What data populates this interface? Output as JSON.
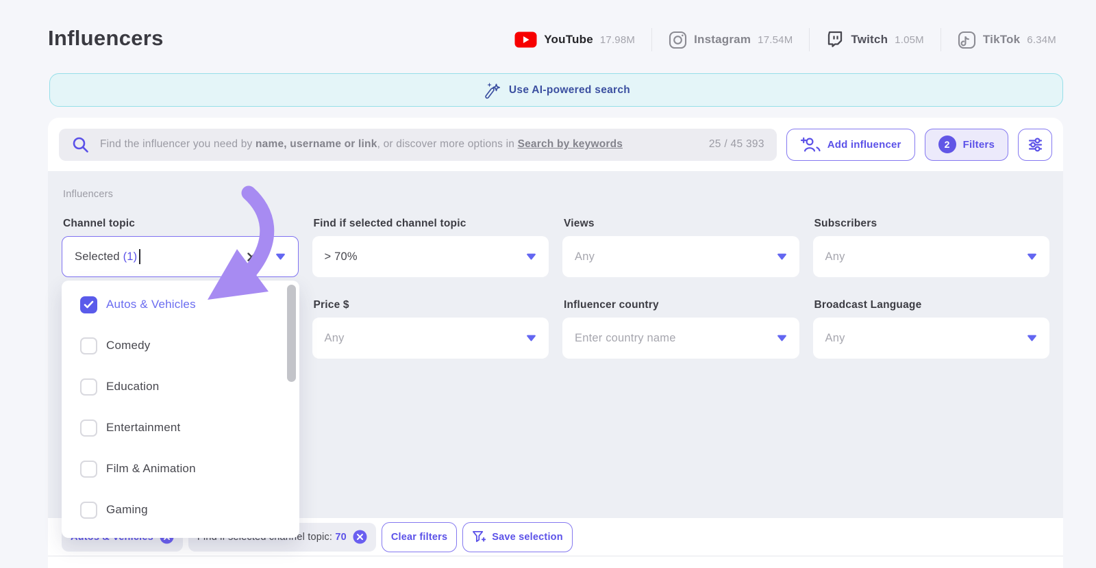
{
  "page": {
    "title": "Influencers"
  },
  "platforms": [
    {
      "name": "YouTube",
      "count": "17.98M"
    },
    {
      "name": "Instagram",
      "count": "17.54M"
    },
    {
      "name": "Twitch",
      "count": "1.05M"
    },
    {
      "name": "TikTok",
      "count": "6.34M"
    }
  ],
  "ai_banner": {
    "label": "Use AI-powered search"
  },
  "search": {
    "placeholder_prefix": "Find the influencer you need by ",
    "placeholder_bold": "name, username or link",
    "placeholder_middle": ", or discover more options in ",
    "placeholder_link": "Search by keywords",
    "results_count": "25 / 45 393"
  },
  "toolbar": {
    "add_influencer_label": "Add influencer",
    "filters_label": "Filters",
    "filters_badge": "2"
  },
  "filters": {
    "section_label": "Influencers",
    "channel_topic": {
      "label": "Channel topic",
      "value": "Selected",
      "value_count": "(1)"
    },
    "topic_match": {
      "label": "Find if selected channel topic",
      "value": "> 70%"
    },
    "views": {
      "label": "Views",
      "placeholder": "Any"
    },
    "subscribers": {
      "label": "Subscribers",
      "placeholder": "Any"
    },
    "price": {
      "label": "Price $",
      "placeholder": "Any"
    },
    "country": {
      "label": "Influencer country",
      "placeholder": "Enter country name"
    },
    "language": {
      "label": "Broadcast Language",
      "placeholder": "Any"
    }
  },
  "dropdown": {
    "options": [
      {
        "label": "Autos & Vehicles",
        "checked": true
      },
      {
        "label": "Comedy",
        "checked": false
      },
      {
        "label": "Education",
        "checked": false
      },
      {
        "label": "Entertainment",
        "checked": false
      },
      {
        "label": "Film & Animation",
        "checked": false
      },
      {
        "label": "Gaming",
        "checked": false
      }
    ]
  },
  "applied_filters": {
    "chip_topic": "Autos & Vehicles",
    "chip_match_label": "Find if selected channel topic: ",
    "chip_match_value": "70",
    "clear_label": "Clear filters",
    "save_label": "Save selection"
  },
  "colors": {
    "accent_purple": "#5b51e8",
    "checkbox_checked": "#5a5bea",
    "youtube_red": "#f70000",
    "banner_text": "#3b4fa0",
    "annotation_arrow": "#a78bf2",
    "panel_gray": "#edeff4"
  }
}
